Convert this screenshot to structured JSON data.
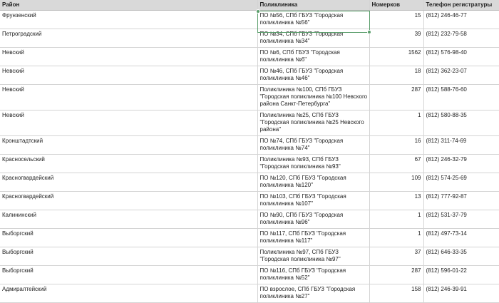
{
  "columns": {
    "district": "Район",
    "clinic": "Поликлиника",
    "numbers": "Номерков",
    "phone": "Телефон регистратуры"
  },
  "rows": [
    {
      "district": "Фрунзенский",
      "clinic": "ПО №56, СПб ГБУЗ \"Городская поликлиника №56\"",
      "numbers": "15",
      "phone": "(812) 246-46-77"
    },
    {
      "district": "Петроградский",
      "clinic": "ПО №34, СПб ГБУЗ \"Городская поликлиника №34\"",
      "numbers": "39",
      "phone": "(812) 232-79-58"
    },
    {
      "district": "Невский",
      "clinic": "ПО №6, СПб ГБУЗ \"Городская поликлиника №6\"",
      "numbers": "1562",
      "phone": "(812) 576-98-40"
    },
    {
      "district": "Невский",
      "clinic": "ПО №46, СПб ГБУЗ \"Городская поликлиника №46\"",
      "numbers": "18",
      "phone": "(812) 362-23-07"
    },
    {
      "district": "Невский",
      "clinic": "Поликлиника №100, СПб ГБУЗ \"Городская поликлиника №100 Невского района Санкт-Петербурга\"",
      "numbers": "287",
      "phone": "(812) 588-76-60"
    },
    {
      "district": "Невский",
      "clinic": "Поликлиника №25, СПб ГБУЗ \"Городская поликлиника №25 Невского района\"",
      "numbers": "1",
      "phone": "(812) 580-88-35"
    },
    {
      "district": "Кронштадтский",
      "clinic": "ПО №74, СПб ГБУЗ \"Городская поликлиника №74\"",
      "numbers": "16",
      "phone": "(812) 311-74-69"
    },
    {
      "district": "Красносельский",
      "clinic": "Поликлиника №93, СПб ГБУЗ \"Городская поликлиника №93\"",
      "numbers": "67",
      "phone": "(812) 246-32-79"
    },
    {
      "district": "Красногвардейский",
      "clinic": "ПО №120, СПб ГБУЗ \"Городская поликлиника №120\"",
      "numbers": "109",
      "phone": "(812) 574-25-69"
    },
    {
      "district": "Красногвардейский",
      "clinic": "ПО №103, СПб ГБУЗ \"Городская поликлиника №107\"",
      "numbers": "13",
      "phone": "(812) 777-92-87"
    },
    {
      "district": "Калининский",
      "clinic": "ПО №90, СПб ГБУЗ \"Городская поликлиника №96\"",
      "numbers": "1",
      "phone": "(812) 531-37-79"
    },
    {
      "district": "Выборгский",
      "clinic": "ПО №117, СПб ГБУЗ \"Городская поликлиника №117\"",
      "numbers": "1",
      "phone": "(812) 497-73-14"
    },
    {
      "district": "Выборгский",
      "clinic": "Поликлиника №97, СПб ГБУЗ \"Городская поликлиника №97\"",
      "numbers": "37",
      "phone": "(812) 646-33-35"
    },
    {
      "district": "Выборгский",
      "clinic": "ПО №116, СПб ГБУЗ \"Городская поликлиника №52\"",
      "numbers": "287",
      "phone": "(812) 596-01-22"
    },
    {
      "district": "Адмиралтейский",
      "clinic": "ПО взрослое, СПб ГБУЗ \"Городская поликлиника №27\"",
      "numbers": "158",
      "phone": "(812) 246-39-91"
    }
  ],
  "colors": {
    "header_bg": "#d9d9d9",
    "selection": "#5a9e6b",
    "grid": "#d4d4d4"
  }
}
